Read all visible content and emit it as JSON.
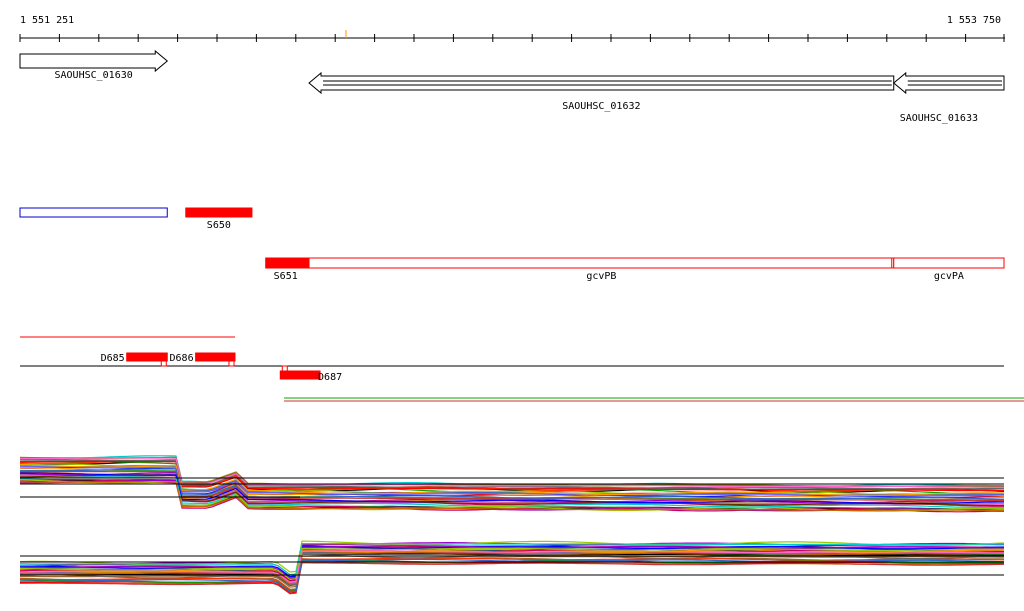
{
  "ruler": {
    "start_label": "1 551 251",
    "end_label": "1 553 750",
    "start": 1551251,
    "end": 1553750
  },
  "genes": [
    {
      "label": "SAOUHSC_01630",
      "start": 1551251,
      "end": 1551625,
      "strand": "+"
    },
    {
      "label": "SAOUHSC_01632",
      "start": 1551985,
      "end": 1553470,
      "strand": "-"
    },
    {
      "label": "SAOUHSC_01633",
      "start": 1553470,
      "end": 1553750,
      "strand": "-"
    }
  ],
  "features_row1": [
    {
      "label": "",
      "start": 1551251,
      "end": 1551625,
      "style": "outline-blue"
    },
    {
      "label": "S650",
      "start": 1551672,
      "end": 1551840,
      "style": "filled-red"
    }
  ],
  "features_row2": [
    {
      "label": "S651",
      "start": 1551875,
      "end": 1551985,
      "style": "filled-red"
    },
    {
      "label": "gcvPB",
      "start": 1551985,
      "end": 1553470,
      "style": "outline-red"
    },
    {
      "label": "gcvPA",
      "start": 1553470,
      "end": 1553750,
      "style": "outline-red"
    }
  ],
  "features_row3": [
    {
      "label": "D685",
      "start": 1551522,
      "end": 1551625,
      "style": "filled-red"
    },
    {
      "label": "D686",
      "start": 1551697,
      "end": 1551797,
      "style": "filled-red"
    },
    {
      "label": "D687",
      "start": 1551912,
      "end": 1552013,
      "style": "filled-red"
    }
  ],
  "colors": {
    "red": "#ff0000",
    "blue": "#0000cc",
    "green": "#00aa00",
    "black": "#000000"
  },
  "expression_tracks": {
    "top": {
      "profile": [
        [
          1551251,
          0
        ],
        [
          1551653,
          0
        ],
        [
          1551662,
          1
        ],
        [
          1551730,
          1
        ],
        [
          1551800,
          0.6
        ],
        [
          1551830,
          1.05
        ],
        [
          1553750,
          1.15
        ]
      ]
    },
    "bottom": {
      "profile": [
        [
          1551251,
          0
        ],
        [
          1551900,
          0
        ],
        [
          1551950,
          1.2
        ],
        [
          1551965,
          -1.7
        ],
        [
          1553750,
          -1.6
        ]
      ]
    }
  }
}
